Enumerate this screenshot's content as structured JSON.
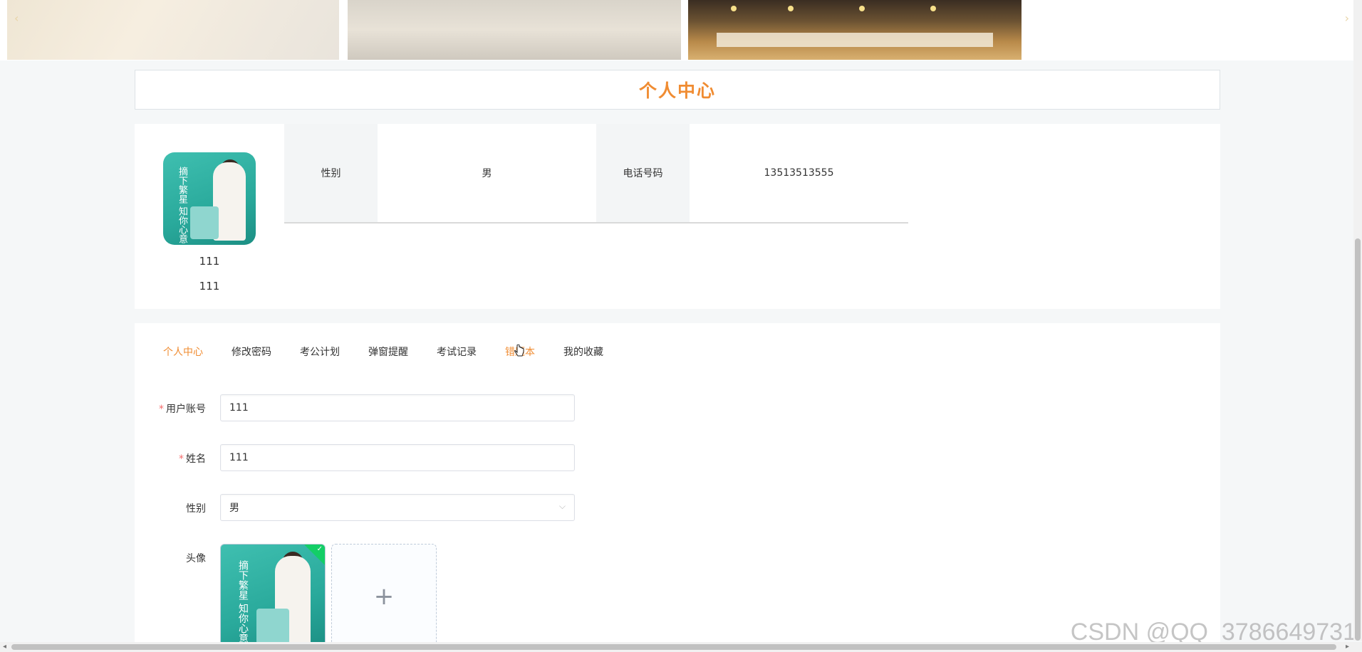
{
  "banner": {
    "prev_label": "‹",
    "next_label": "›"
  },
  "page": {
    "title": "个人中心"
  },
  "profile": {
    "avatar_text": "摘下繁星 知你心意",
    "username": "111",
    "name": "111",
    "info": [
      {
        "label": "性别",
        "value": "男"
      },
      {
        "label": "电话号码",
        "value": "13513513555"
      }
    ]
  },
  "tabs": [
    {
      "label": "个人中心",
      "active": true
    },
    {
      "label": "修改密码"
    },
    {
      "label": "考公计划"
    },
    {
      "label": "弹窗提醒"
    },
    {
      "label": "考试记录"
    },
    {
      "label": "错题本"
    },
    {
      "label": "我的收藏"
    }
  ],
  "form": {
    "account_label": "用户账号",
    "account_value": "111",
    "name_label": "姓名",
    "name_value": "111",
    "gender_label": "性别",
    "gender_value": "男",
    "avatar_label": "头像",
    "required_mark": "*",
    "add_symbol": "+"
  },
  "watermark": "CSDN @QQ_3786649731",
  "colors": {
    "accent": "#f08c32",
    "required": "#f56c6c",
    "success": "#13ce66"
  },
  "icons": {
    "select_chevron": "chevron-down-icon",
    "upload_add": "plus-icon",
    "upload_success": "check-icon"
  }
}
